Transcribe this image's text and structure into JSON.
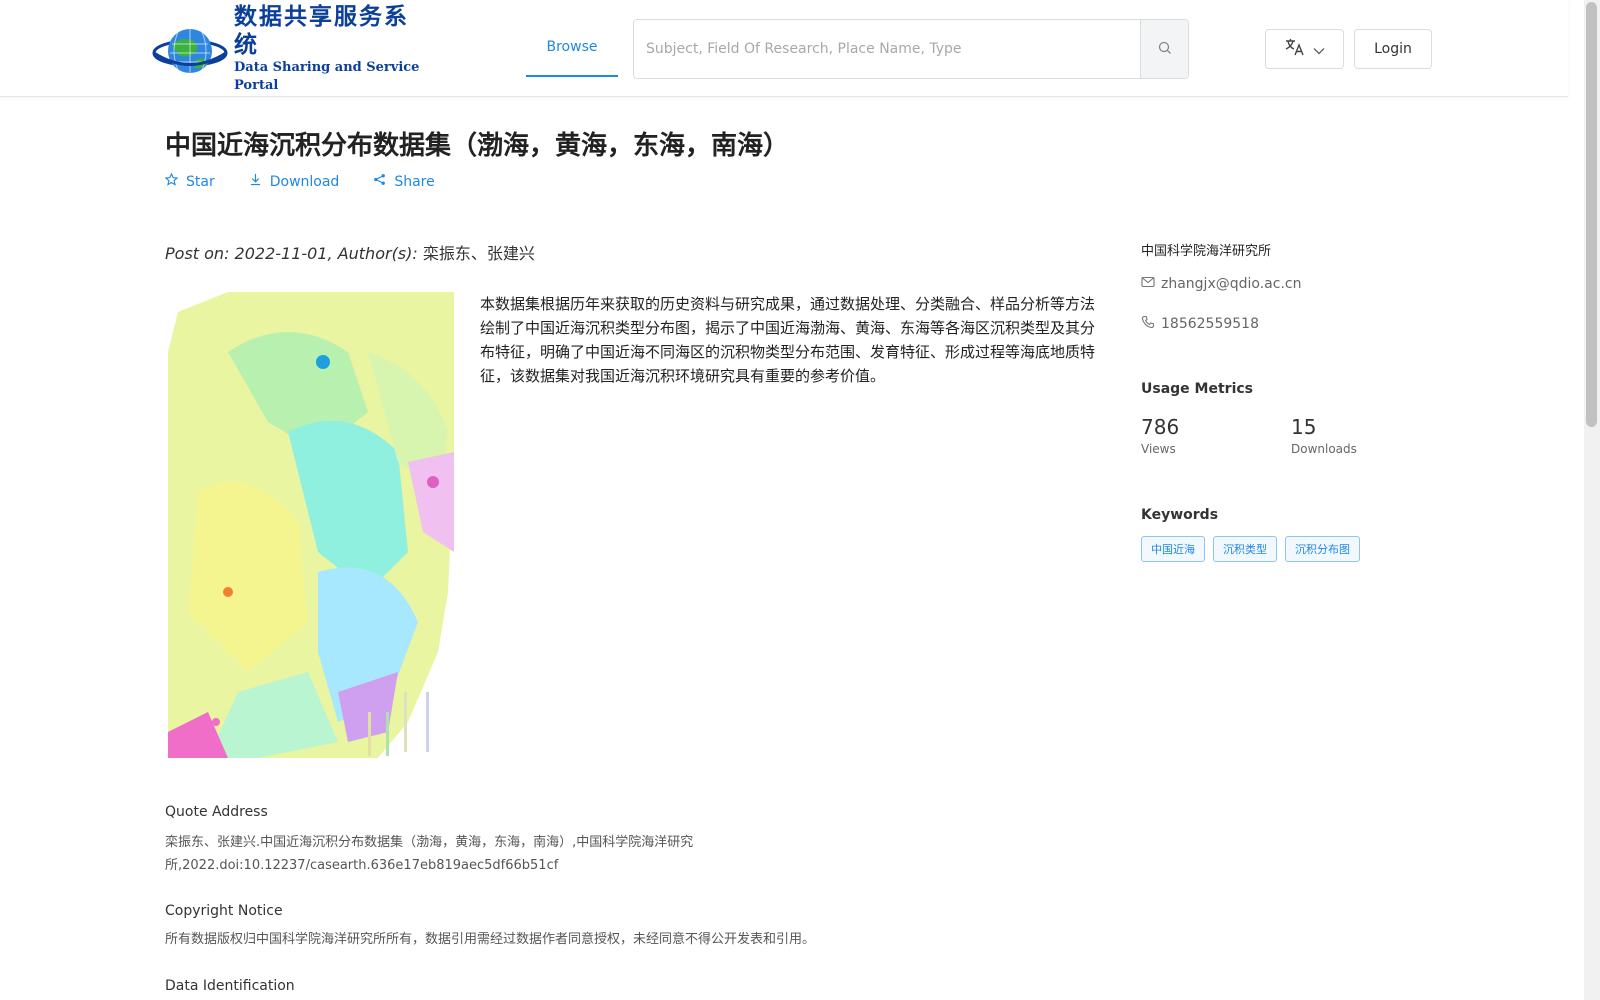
{
  "header": {
    "logo_cn": "数据共享服务系统",
    "logo_en": "Data Sharing and Service Portal",
    "nav_browse": "Browse",
    "search_placeholder": "Subject, Field Of Research, Place Name, Type",
    "login": "Login"
  },
  "dataset": {
    "title": "中国近海沉积分布数据集（渤海，黄海，东海，南海）",
    "actions": {
      "star": "Star",
      "download": "Download",
      "share": "Share"
    },
    "post_prefix": "Post on: 2022-11-01, Author(s): ",
    "authors": "栾振东、张建兴",
    "description": "本数据集根据历年来获取的历史资料与研究成果，通过数据处理、分类融合、样品分析等方法绘制了中国近海沉积类型分布图，揭示了中国近海渤海、黄海、东海等各海区沉积类型及其分布特征，明确了中国近海不同海区的沉积物类型分布范围、发育特征、形成过程等海底地质特征，该数据集对我国近海沉积环境研究具有重要的参考价值。"
  },
  "sidebar": {
    "organization": "中国科学院海洋研究所",
    "email": "zhangjx@qdio.ac.cn",
    "phone": "18562559518",
    "metrics_heading": "Usage Metrics",
    "views_value": "786",
    "views_label": "Views",
    "downloads_value": "15",
    "downloads_label": "Downloads",
    "keywords_heading": "Keywords",
    "keywords": [
      "中国近海",
      "沉积类型",
      "沉积分布图"
    ]
  },
  "sections": {
    "quote_title": "Quote Address",
    "quote_text": "栾振东、张建兴.中国近海沉积分布数据集（渤海，黄海，东海，南海）,中国科学院海洋研究所,2022.doi:10.12237/casearth.636e17eb819aec5df66b51cf",
    "copyright_title": "Copyright Notice",
    "copyright_text": "所有数据版权归中国科学院海洋研究所所有，数据引用需经过数据作者同意授权，未经同意不得公开发表和引用。",
    "identification_title": "Data Identification"
  },
  "colors": {
    "accent": "#1e88e5",
    "logo": "#0b3f9a"
  },
  "icons": [
    "globe-logo-icon",
    "search-icon",
    "translate-icon",
    "chevron-down-icon",
    "star-icon",
    "download-icon",
    "share-icon",
    "mail-icon",
    "phone-icon"
  ]
}
